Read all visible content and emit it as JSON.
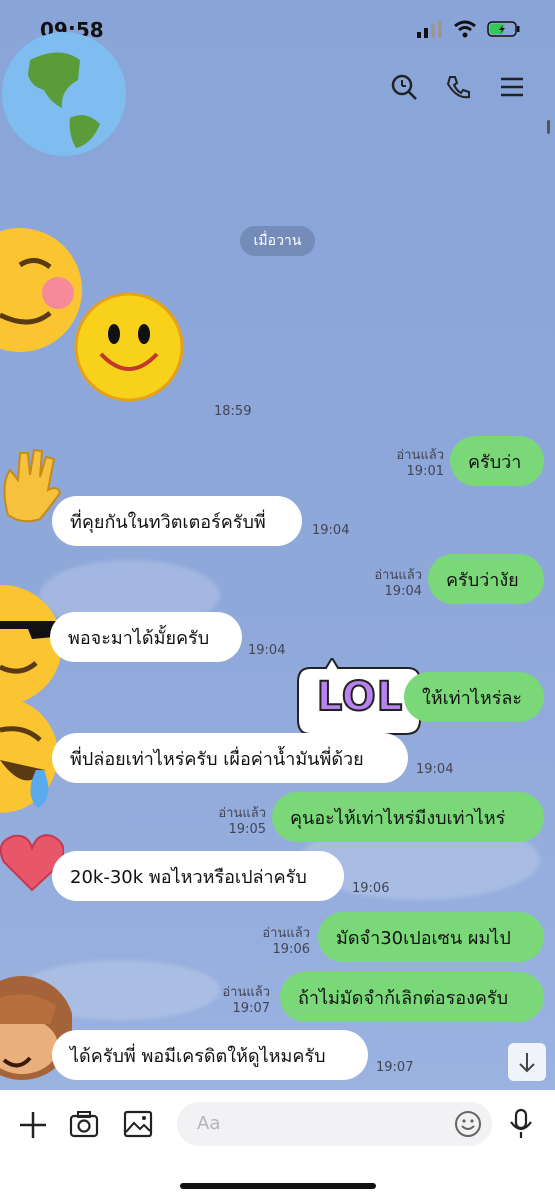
{
  "status_bar": {
    "time": "09:58"
  },
  "chat": {
    "date_divider": "เมื่อวาน",
    "messages": [
      {
        "side": "in",
        "time": "18:59"
      },
      {
        "side": "out",
        "text": "ครับว่า",
        "read": "อ่านแล้ว",
        "time": "19:01"
      },
      {
        "side": "in",
        "text": "ที่คุยกันในทวิตเตอร์ครับพี่",
        "time": "19:04"
      },
      {
        "side": "out",
        "text": "ครับว่างัย",
        "read": "อ่านแล้ว",
        "time": "19:04"
      },
      {
        "side": "in",
        "text": "พอจะมาได้มั้ยครับ",
        "time": "19:04"
      },
      {
        "side": "out",
        "text": "ให้เท่าไหร่ละ"
      },
      {
        "side": "in",
        "text": "พี่ปล่อยเท่าไหร่ครับ เผื่อค่าน้ำมันพี่ด้วย",
        "time": "19:04"
      },
      {
        "side": "out",
        "text": "คุนอะไห้เท่าไหร่มีงบเท่าไหร่",
        "read": "อ่านแล้ว",
        "time": "19:05"
      },
      {
        "side": "in",
        "text": "20k-30k พอไหวหรือเปล่าครับ",
        "time": "19:06"
      },
      {
        "side": "out",
        "text": "มัดจำ30เปอเซน ผมไป",
        "read": "อ่านแล้ว",
        "time": "19:06"
      },
      {
        "side": "out",
        "text": "ถ้าไม่มัดจำก้เลิกต่อรองครับ",
        "read": "อ่านแล้ว",
        "time": "19:07"
      },
      {
        "side": "in",
        "text": "ได้ครับพี่ พอมีเครดิตให้ดูไหมครับ",
        "time": "19:07"
      }
    ],
    "sticker_text": "LOL"
  },
  "input_bar": {
    "placeholder": "Aa"
  },
  "colors": {
    "outgoing": "#7ad879",
    "incoming": "#ffffff",
    "background": "#8aa3d6"
  }
}
